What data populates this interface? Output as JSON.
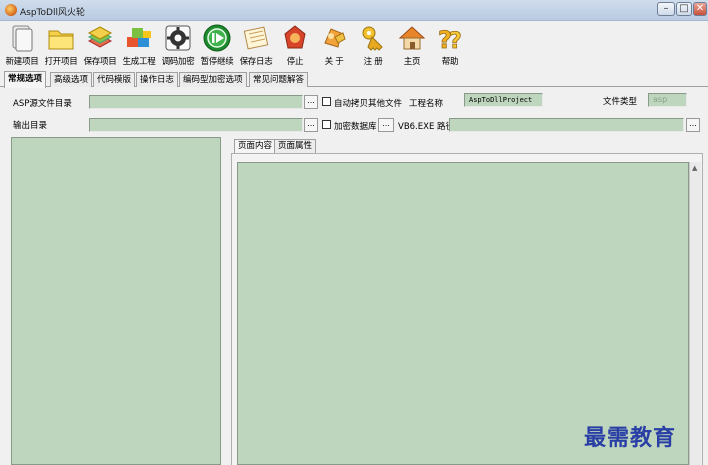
{
  "window": {
    "title": "AspToDll风火轮"
  },
  "toolbar": {
    "items": [
      {
        "label": "新建项目",
        "icon": "new-project-icon"
      },
      {
        "label": "打开项目",
        "icon": "open-folder-icon"
      },
      {
        "label": "保存项目",
        "icon": "save-books-icon"
      },
      {
        "label": "生成工程",
        "icon": "build-blocks-icon"
      },
      {
        "label": "调码加密",
        "icon": "gear-encrypt-icon"
      },
      {
        "label": "暂停继续",
        "icon": "play-pause-icon"
      },
      {
        "label": "保存日志",
        "icon": "save-log-icon"
      },
      {
        "label": "停止",
        "icon": "stop-icon"
      },
      {
        "label": "关  于",
        "icon": "about-icon"
      },
      {
        "label": "注  册",
        "icon": "register-key-icon"
      },
      {
        "label": "主页",
        "icon": "home-icon"
      },
      {
        "label": "帮助",
        "icon": "help-icon"
      }
    ]
  },
  "tabs": [
    "常规选项",
    "高级选项",
    "代码模版",
    "操作日志",
    "编码型加密选项",
    "常见问题解答"
  ],
  "form": {
    "asp_dir_label": "ASP源文件目录",
    "asp_dir_value": "",
    "output_dir_label": "输出目录",
    "output_dir_value": "",
    "auto_copy_label": "自动拷贝其他文件",
    "project_name_label": "工程名称",
    "project_name_value": "AspToDllProject",
    "file_type_label": "文件类型",
    "file_type_value": "asp",
    "encrypt_db_label": "加密数据库",
    "vb6_path_label": "VB6.EXE 路径",
    "vb6_path_value": "",
    "browse_label": "..."
  },
  "subtabs": [
    "页面内容",
    "页面属性"
  ],
  "watermark": {
    "text": "最需教育"
  },
  "colors": {
    "field_bg": "#bed6bd",
    "watermark": "#2a3fa6"
  }
}
